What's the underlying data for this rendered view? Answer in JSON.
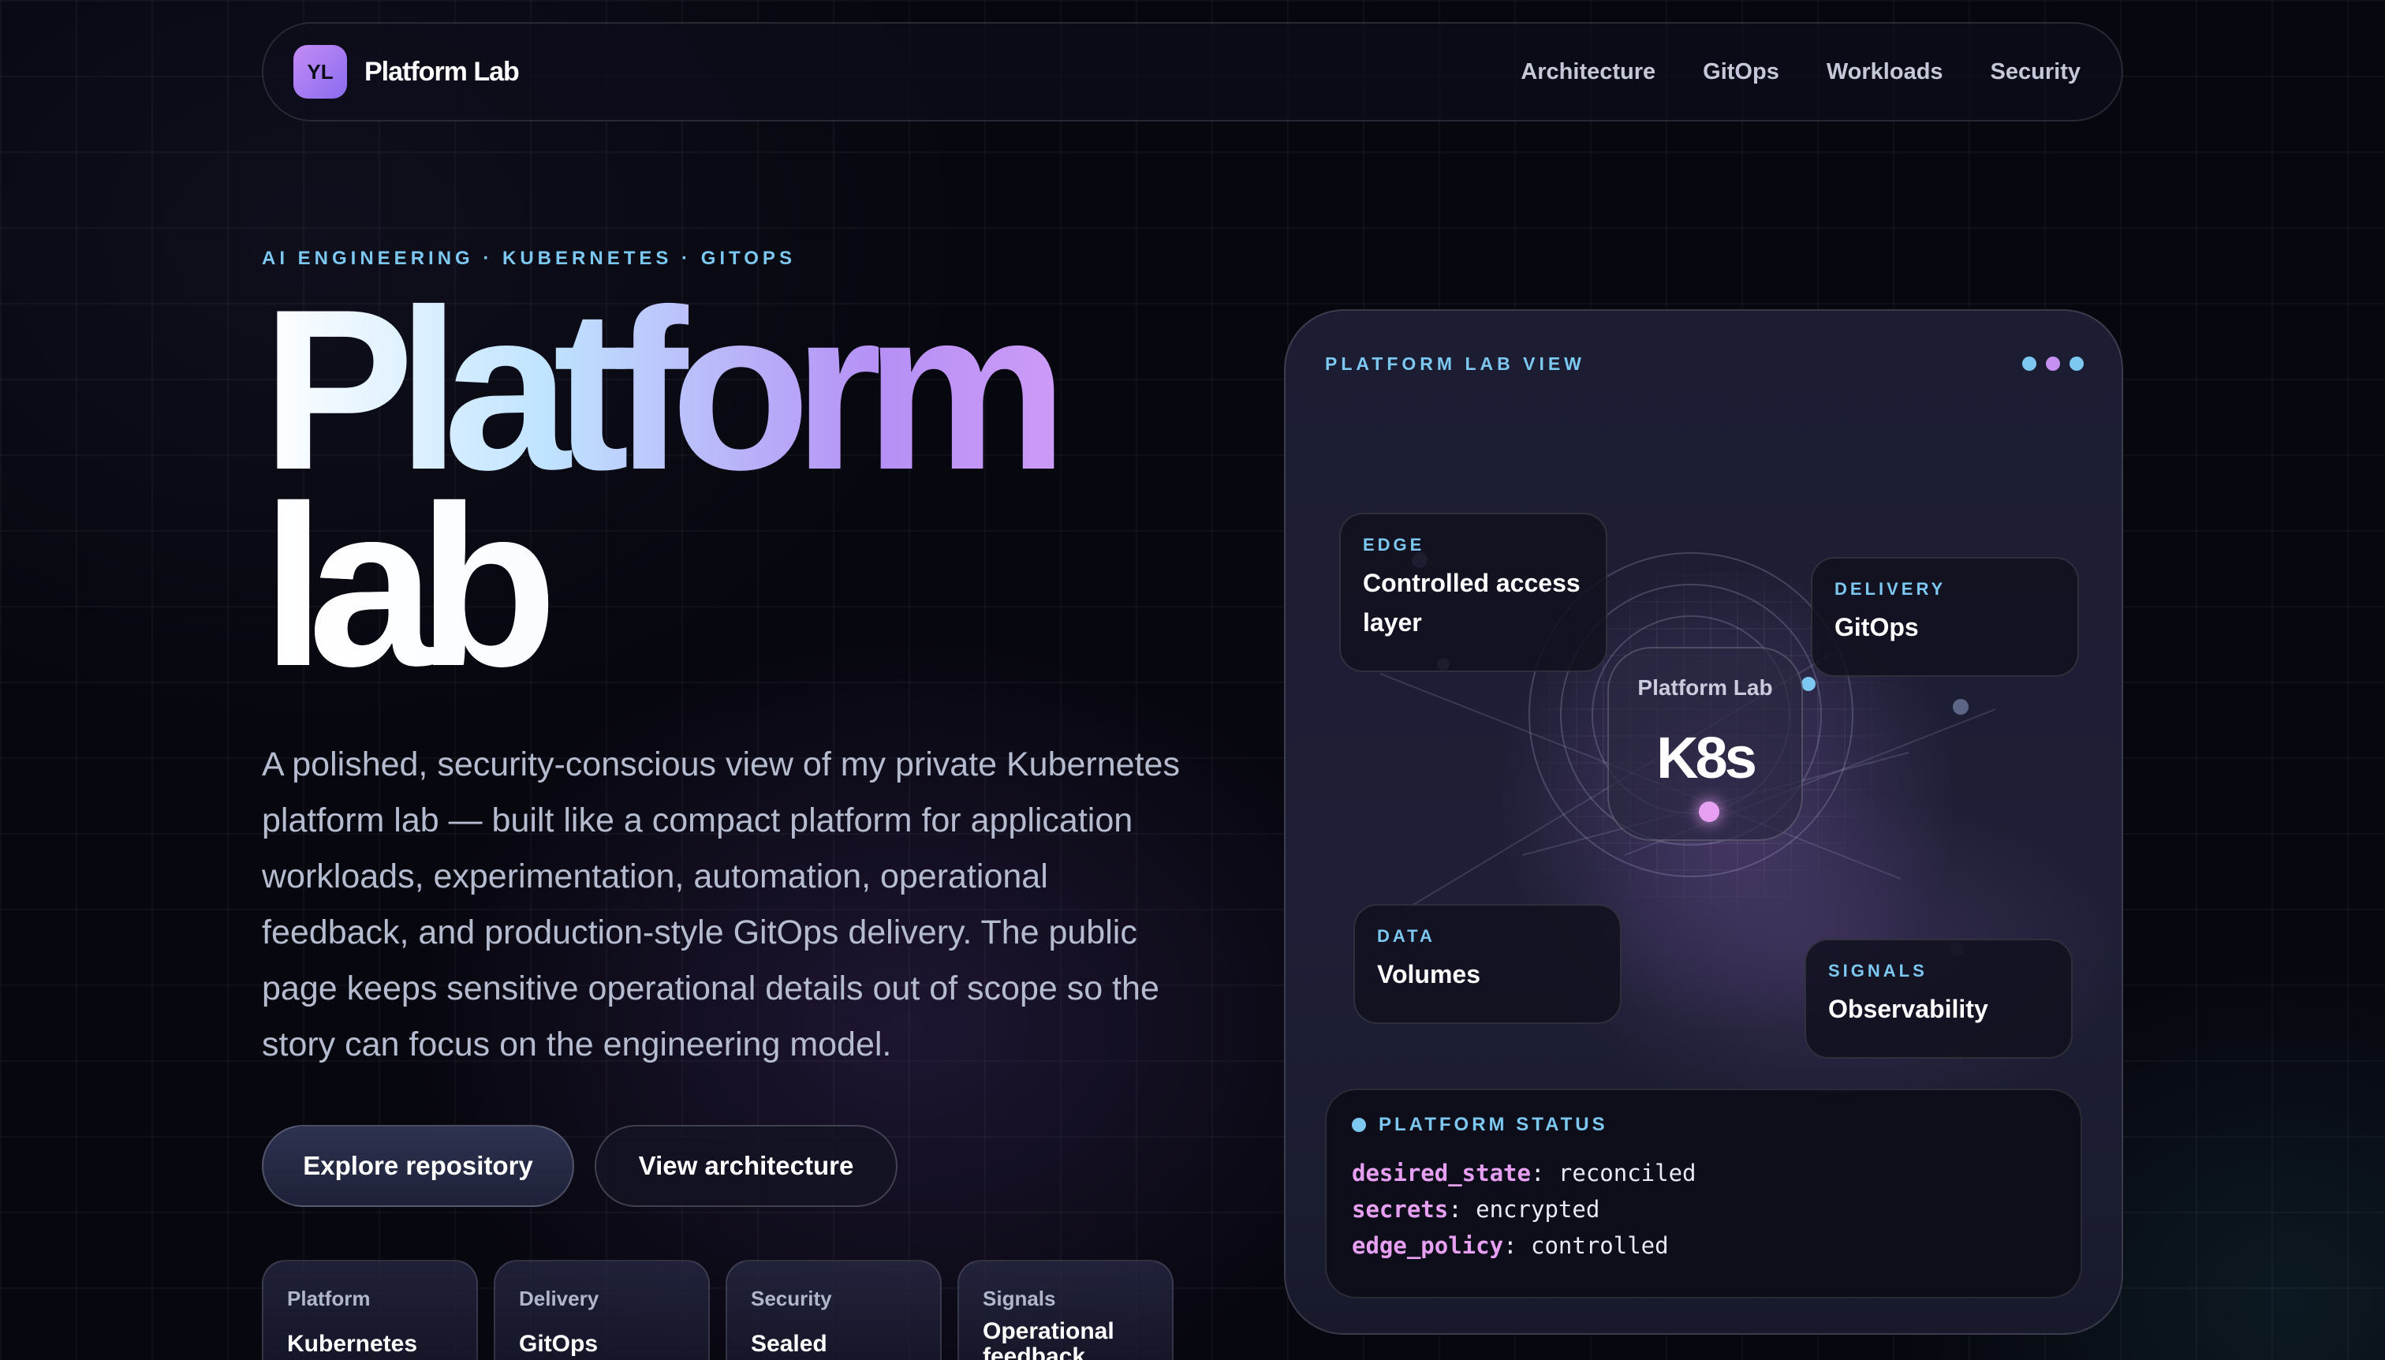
{
  "nav": {
    "logo_initials": "YL",
    "brand": "Platform Lab",
    "links": [
      "Architecture",
      "GitOps",
      "Workloads",
      "Security"
    ]
  },
  "hero": {
    "eyebrow": "AI ENGINEERING · KUBERNETES · GITOPS",
    "title_line1": "Platform",
    "title_line2": "lab",
    "description": "A polished, security-conscious view of my private Kubernetes platform lab — built like a compact platform for application workloads, experimentation, automation, operational feedback, and production-style GitOps delivery. The public page keeps sensitive operational details out of scope so the story can focus on the engineering model.",
    "primary_button": "Explore repository",
    "secondary_button": "View architecture"
  },
  "mini_cards": [
    {
      "label": "Platform",
      "value": "Kubernetes"
    },
    {
      "label": "Delivery",
      "value": "GitOps"
    },
    {
      "label": "Security",
      "value": "Sealed secrets"
    },
    {
      "label": "Signals",
      "value": "Operational feedback"
    }
  ],
  "panel": {
    "title": "PLATFORM LAB VIEW",
    "core_label": "Platform Lab",
    "core_value": "K8s",
    "nodes": {
      "edge": {
        "eyebrow": "EDGE",
        "title": "Controlled access layer"
      },
      "delivery": {
        "eyebrow": "DELIVERY",
        "title": "GitOps"
      },
      "data": {
        "eyebrow": "DATA",
        "title": "Volumes"
      },
      "signals": {
        "eyebrow": "SIGNALS",
        "title": "Observability"
      }
    },
    "status": {
      "title": "PLATFORM STATUS",
      "lines": [
        {
          "key": "desired_state",
          "value": "reconciled"
        },
        {
          "key": "secrets",
          "value": "encrypted"
        },
        {
          "key": "edge_policy",
          "value": "controlled"
        }
      ]
    }
  },
  "colors": {
    "accent_cyan": "#7cc8f0",
    "accent_pink": "#e79ff2",
    "accent_purple": "#b590f5",
    "background": "#07070f"
  }
}
